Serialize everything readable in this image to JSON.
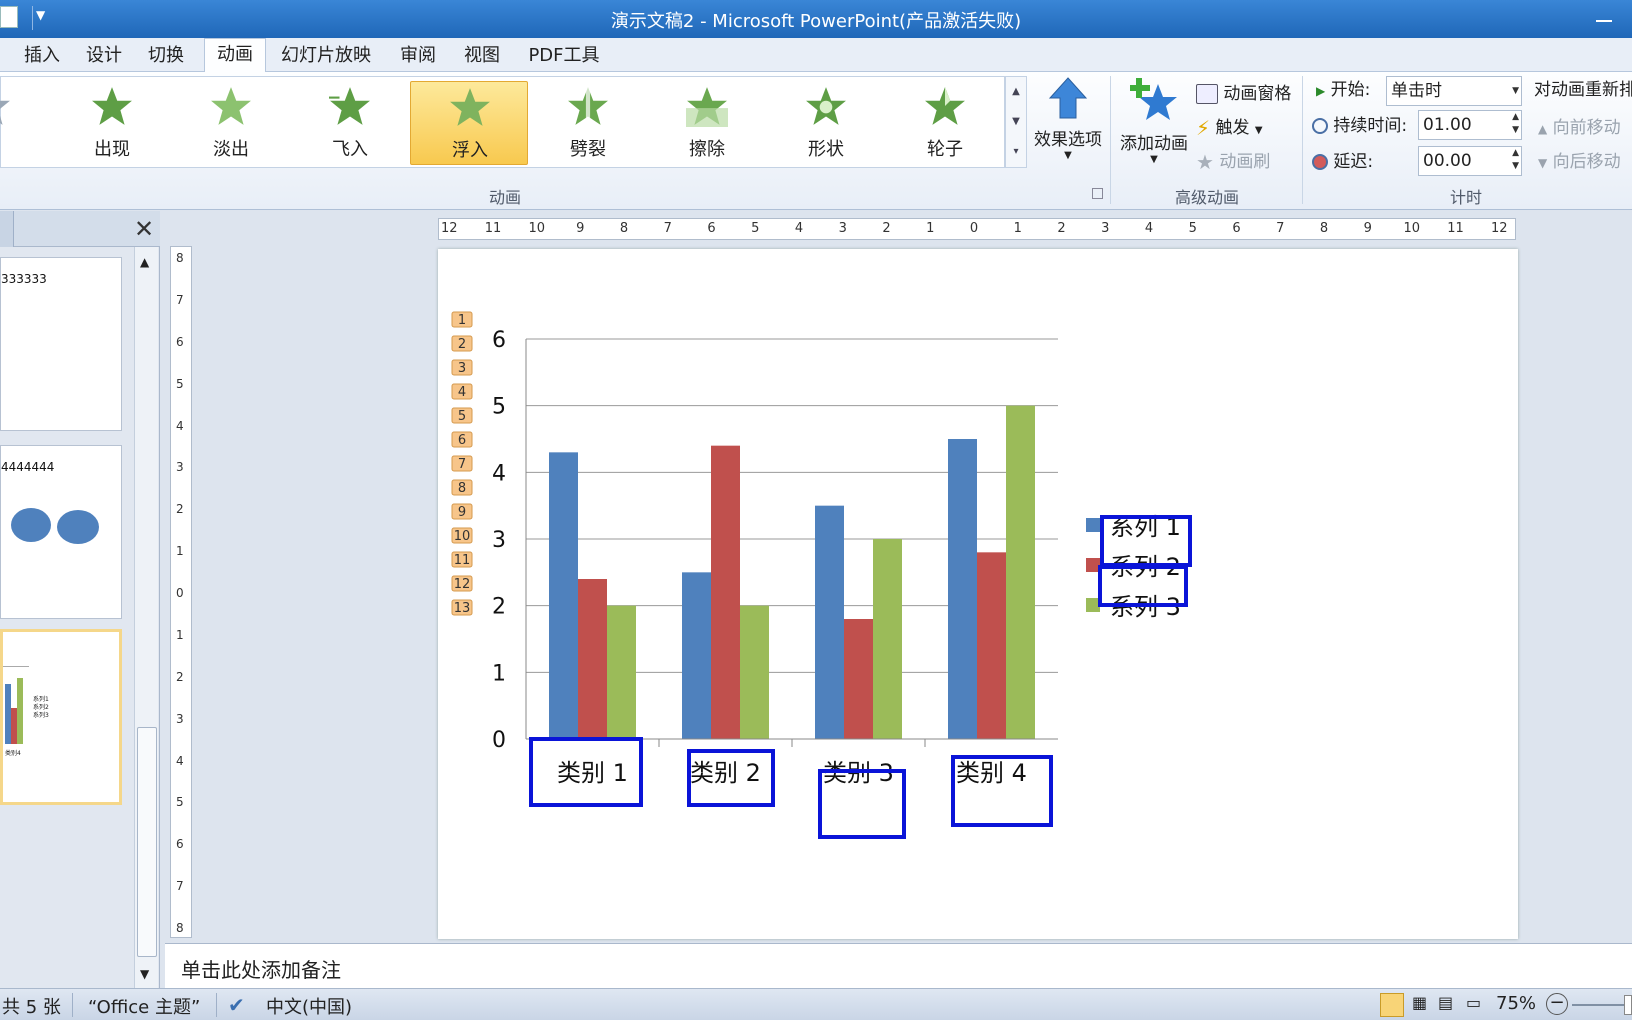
{
  "window": {
    "title": "演示文稿2 - Microsoft PowerPoint(产品激活失败)"
  },
  "tabs": [
    {
      "label": "插入"
    },
    {
      "label": "设计"
    },
    {
      "label": "切换"
    },
    {
      "label": "动画"
    },
    {
      "label": "幻灯片放映"
    },
    {
      "label": "审阅"
    },
    {
      "label": "视图"
    },
    {
      "label": "PDF工具"
    }
  ],
  "active_tab": "动画",
  "ribbon": {
    "animations": [
      {
        "label": "出现",
        "icon": "star-appear-icon"
      },
      {
        "label": "淡出",
        "icon": "star-fade-icon"
      },
      {
        "label": "飞入",
        "icon": "star-fly-in-icon"
      },
      {
        "label": "浮入",
        "icon": "star-float-in-icon"
      },
      {
        "label": "劈裂",
        "icon": "star-split-icon"
      },
      {
        "label": "擦除",
        "icon": "star-wipe-icon"
      },
      {
        "label": "形状",
        "icon": "star-shape-icon"
      },
      {
        "label": "轮子",
        "icon": "star-wheel-icon"
      }
    ],
    "selected_animation": "浮入",
    "effect_options": "效果选项",
    "animation_group_label": "动画",
    "add_animation": "添加动画",
    "animation_pane": "动画窗格",
    "trigger": "触发",
    "animation_painter": "动画刷",
    "advanced_group_label": "高级动画",
    "start_label": "开始:",
    "start_value": "单击时",
    "duration_label": "持续时间:",
    "duration_value": "01.00",
    "delay_label": "延迟:",
    "delay_value": "00.00",
    "timing_group_label": "计时",
    "reorder_label": "对动画重新排",
    "move_earlier": "向前移动",
    "move_later": "向后移动",
    "colors": {
      "accent_green": "#6aa84f",
      "selected_bg": "#f8c94f"
    }
  },
  "slide_panel": {
    "thumbnails": [
      {
        "text": "333333"
      },
      {
        "text": "4444444"
      },
      {
        "text": ""
      }
    ],
    "mini_legend": [
      "系列1",
      "系列2",
      "系列3"
    ],
    "mini_category": "类别4"
  },
  "ruler": {
    "h_ticks": [
      "12",
      "11",
      "10",
      "9",
      "8",
      "7",
      "6",
      "5",
      "4",
      "3",
      "2",
      "1",
      "0",
      "1",
      "2",
      "3",
      "4",
      "5",
      "6",
      "7",
      "8",
      "9",
      "10",
      "11",
      "12"
    ],
    "v_ticks": [
      "8",
      "7",
      "6",
      "5",
      "4",
      "3",
      "2",
      "1",
      "0",
      "1",
      "2",
      "3",
      "4",
      "5",
      "6",
      "7",
      "8"
    ]
  },
  "animation_markers": [
    "1",
    "2",
    "3",
    "4",
    "5",
    "6",
    "7",
    "8",
    "9",
    "10",
    "11",
    "12",
    "13"
  ],
  "chart_data": {
    "type": "bar",
    "categories": [
      "类别 1",
      "类别 2",
      "类别 3",
      "类别 4"
    ],
    "series": [
      {
        "name": "系列 1",
        "values": [
          4.3,
          2.5,
          3.5,
          4.5
        ],
        "color": "#4f81bd"
      },
      {
        "name": "系列 2",
        "values": [
          2.4,
          4.4,
          1.8,
          2.8
        ],
        "color": "#c0504d"
      },
      {
        "name": "系列 3",
        "values": [
          2.0,
          2.0,
          3.0,
          5.0
        ],
        "color": "#9bbb59"
      }
    ],
    "ylim": [
      0,
      6
    ],
    "yticks": [
      "0",
      "1",
      "2",
      "3",
      "4",
      "5",
      "6"
    ],
    "grid": true,
    "legend": "right",
    "highlight_color": "#0a14d8"
  },
  "notes": {
    "placeholder": "单击此处添加备注"
  },
  "status": {
    "slides": "共 5 张",
    "theme": "“Office 主题”",
    "language": "中文(中国)",
    "zoom": "75%"
  }
}
